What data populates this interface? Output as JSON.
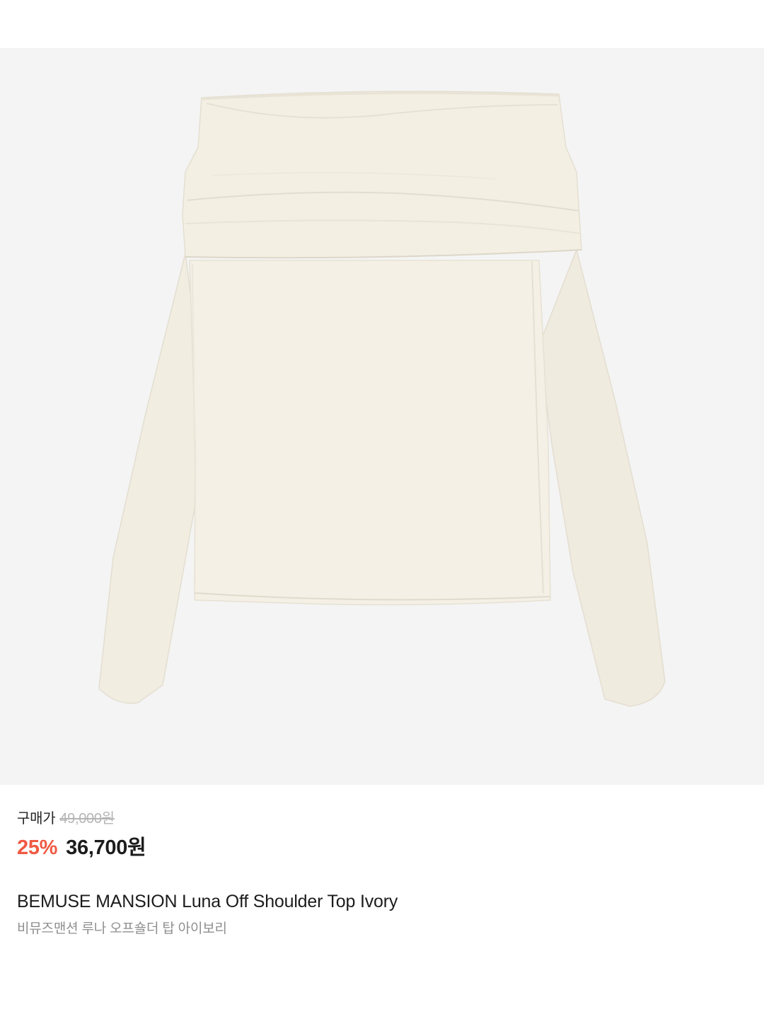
{
  "product": {
    "image_alt": "BEMUSE MANSION Luna Off Shoulder Top Ivory",
    "garment_color": "#f2eee2",
    "image_background": "#f4f4f4"
  },
  "pricing": {
    "buy_label": "구매가",
    "original_price": "49,000원",
    "discount_rate": "25%",
    "sale_price": "36,700원",
    "discount_color": "#ef5a43"
  },
  "title": {
    "english": "BEMUSE MANSION Luna Off Shoulder Top Ivory",
    "korean": "비뮤즈맨션 루나 오프숄더 탑 아이보리"
  }
}
